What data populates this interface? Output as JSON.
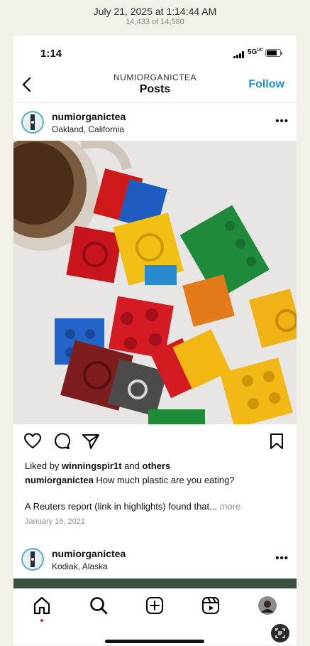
{
  "photo_viewer": {
    "date": "July 21, 2025 at 1:14:44 AM",
    "counter": "14,433 of 14,580"
  },
  "status_bar": {
    "time": "1:14",
    "network": "5G",
    "network_uc": "UC",
    "battery_percent": 80
  },
  "header": {
    "username": "NUMIORGANICTEA",
    "title": "Posts",
    "follow_label": "Follow"
  },
  "post": {
    "username": "numiorganictea",
    "location": "Oakland, California",
    "more_icon": "ellipsis-icon",
    "liked_prefix": "Liked by",
    "liked_user": "winningspir1t",
    "liked_and": "and",
    "liked_others": "others",
    "caption_user": "numiorganictea",
    "caption_text": "How much plastic are you eating?",
    "caption_cont": "A Reuters report (link in highlights) found that...",
    "more_label": "more",
    "date": "January 16, 2021"
  },
  "next_post": {
    "username": "numiorganictea",
    "location": "Kodiak, Alaska"
  },
  "tabs": [
    "home-icon",
    "search-icon",
    "create-icon",
    "reels-icon",
    "profile-avatar"
  ],
  "colors": {
    "accent": "#1890e8",
    "notification_dot": "#e0245e"
  }
}
